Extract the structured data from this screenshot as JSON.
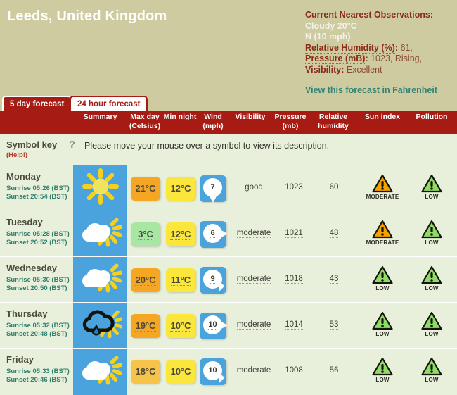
{
  "header": {
    "location_title": "Leeds, United Kingdom",
    "observations": {
      "heading": "Current Nearest Observations",
      "conditions": "Cloudy 20°C",
      "wind": "N (10 mph)",
      "humidity_label": "Relative Humidity (%)",
      "humidity_value": "61,",
      "pressure_label": "Pressure (mB)",
      "pressure_value": "1023, Rising,",
      "visibility_label": "Visibility",
      "visibility_value": "Excellent"
    },
    "fahrenheit_link": "View this forecast in Fahrenheit"
  },
  "tabs": [
    {
      "label": "5 day forecast",
      "active": true
    },
    {
      "label": "24 hour forecast",
      "active": false
    }
  ],
  "columns": [
    {
      "label": "Summary",
      "line2": ""
    },
    {
      "label": "Max day",
      "line2": "(Celsius)"
    },
    {
      "label": "Min night",
      "line2": ""
    },
    {
      "label": "Wind",
      "line2": "(mph)"
    },
    {
      "label": "Visibility",
      "line2": ""
    },
    {
      "label": "Pressure",
      "line2": "(mb)"
    },
    {
      "label": "Relative",
      "line2": "humidity"
    },
    {
      "label": "Sun index",
      "line2": ""
    },
    {
      "label": "Pollution",
      "line2": ""
    }
  ],
  "symbol_key": {
    "title": "Symbol key",
    "help": "(Help!)",
    "question_icon": "?",
    "message": "Please move your mouse over a symbol to view its description."
  },
  "colors": {
    "banner_bg": "#cdcb9f",
    "accent_red": "#a61c15",
    "row_bg": "#e8f0dc",
    "summary_tile": "#4aa3dd",
    "link_teal": "#2f8375",
    "chip_orange": "#f5a623",
    "chip_yellow": "#fbe63b",
    "chip_green": "#a8e6a3",
    "warn_orange": "#f5a100",
    "warn_green": "#8fdc63"
  },
  "forecast_rows": [
    {
      "day": "Monday",
      "sunrise": "Sunrise 05:26 (BST)",
      "sunset": "Sunset 20:54 (BST)",
      "summary_icon": "sunny-icon",
      "max_day": "21°C",
      "max_day_color": "#f5a623",
      "min_night": "12°C",
      "wind_speed": "7",
      "wind_dir": "s",
      "visibility": "good",
      "pressure": "1023",
      "humidity": "60",
      "sun_index": "MODERATE",
      "sun_index_level": "moderate",
      "pollution": "LOW",
      "pollution_level": "low"
    },
    {
      "day": "Tuesday",
      "sunrise": "Sunrise 05:28 (BST)",
      "sunset": "Sunset 20:52 (BST)",
      "summary_icon": "sunny-intervals-icon",
      "max_day": "3°C",
      "max_day_color": "#a8e6a3",
      "min_night": "12°C",
      "wind_speed": "6",
      "wind_dir": "e",
      "visibility": "moderate",
      "pressure": "1021",
      "humidity": "48",
      "sun_index": "MODERATE",
      "sun_index_level": "moderate",
      "pollution": "LOW",
      "pollution_level": "low"
    },
    {
      "day": "Wednesday",
      "sunrise": "Sunrise 05:30 (BST)",
      "sunset": "Sunset 20:50 (BST)",
      "summary_icon": "sunny-intervals-icon",
      "max_day": "20°C",
      "max_day_color": "#f5a623",
      "min_night": "11°C",
      "wind_speed": "9",
      "wind_dir": "se",
      "visibility": "moderate",
      "pressure": "1018",
      "humidity": "43",
      "sun_index": "LOW",
      "sun_index_level": "low",
      "pollution": "LOW",
      "pollution_level": "low"
    },
    {
      "day": "Thursday",
      "sunrise": "Sunrise 05:32 (BST)",
      "sunset": "Sunset 20:48 (BST)",
      "summary_icon": "sunny-showers-icon",
      "max_day": "19°C",
      "max_day_color": "#f5a623",
      "min_night": "10°C",
      "wind_speed": "10",
      "wind_dir": "e",
      "visibility": "moderate",
      "pressure": "1014",
      "humidity": "53",
      "sun_index": "LOW",
      "sun_index_level": "low",
      "pollution": "LOW",
      "pollution_level": "low"
    },
    {
      "day": "Friday",
      "sunrise": "Sunrise 05:33 (BST)",
      "sunset": "Sunset 20:46 (BST)",
      "summary_icon": "sunny-intervals-icon",
      "max_day": "18°C",
      "max_day_color": "#f7c34a",
      "min_night": "10°C",
      "wind_speed": "10",
      "wind_dir": "se",
      "visibility": "moderate",
      "pressure": "1008",
      "humidity": "56",
      "sun_index": "LOW",
      "sun_index_level": "low",
      "pollution": "LOW",
      "pollution_level": "low"
    }
  ]
}
